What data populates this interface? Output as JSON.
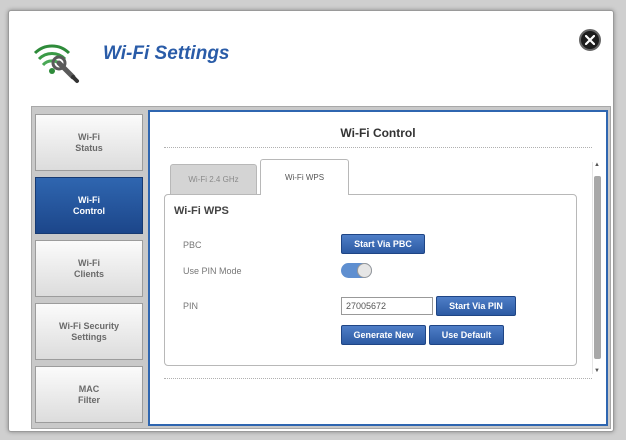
{
  "window": {
    "title": "Wi-Fi Settings"
  },
  "sidebar": {
    "items": [
      {
        "label": "Wi-Fi\nStatus",
        "active": false
      },
      {
        "label": "Wi-Fi\nControl",
        "active": true
      },
      {
        "label": "Wi-Fi\nClients",
        "active": false
      },
      {
        "label": "Wi-Fi Security\nSettings",
        "active": false
      },
      {
        "label": "MAC\nFilter",
        "active": false
      }
    ]
  },
  "main": {
    "section_title": "Wi-Fi Control",
    "tabs": [
      {
        "label": "Wi-Fi 2.4 GHz",
        "active": false
      },
      {
        "label": "Wi-Fi WPS",
        "active": true
      }
    ],
    "wps": {
      "heading": "Wi-Fi WPS",
      "pbc_label": "PBC",
      "pbc_button": "Start Via PBC",
      "pin_mode_label": "Use PIN Mode",
      "pin_mode_enabled": true,
      "pin_label": "PIN",
      "pin_value": "27005672",
      "pin_button": "Start Via PIN",
      "generate_button": "Generate New",
      "default_button": "Use Default"
    }
  },
  "colors": {
    "accent": "#2f66b0",
    "title": "#2a5ca8",
    "button": "#2c5aa3"
  },
  "icons": {
    "header": "wifi-wrench-icon",
    "close": "close-icon"
  }
}
